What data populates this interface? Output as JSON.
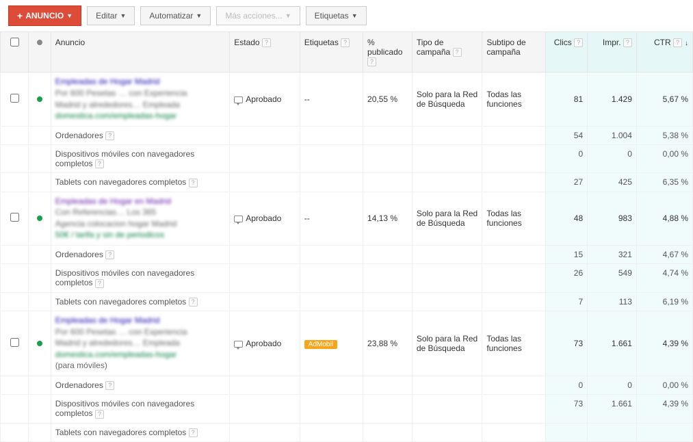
{
  "toolbar": {
    "primary": "Anuncio",
    "edit": "Editar",
    "automate": "Automatizar",
    "more": "Más acciones...",
    "labels": "Etiquetas"
  },
  "headers": {
    "ad": "Anuncio",
    "state": "Estado",
    "labels": "Etiquetas",
    "pct": "% publicado",
    "type": "Tipo de campaña",
    "subtype": "Subtipo de campaña",
    "clicks": "Clics",
    "impr": "Impr.",
    "ctr": "CTR"
  },
  "rows": [
    {
      "ad": {
        "t": "Empleadas de Hogar Madrid",
        "l1": "Por 600 Pesetas … con Experiencia",
        "l2": "Madrid y alrededores… Empleada",
        "l3": "domestica.com/empleadas-hogar",
        "mobiles": ""
      },
      "state": "Aprobado",
      "etq": "--",
      "pct": "20,55 %",
      "type": "Solo para la Red de Búsqueda",
      "sub": "Todas las funciones",
      "clicks": "81",
      "impr": "1.429",
      "ctr": "5,67 %",
      "devices": [
        {
          "name": "Ordenadores",
          "clicks": "54",
          "impr": "1.004",
          "ctr": "5,38 %"
        },
        {
          "name": "Dispositivos móviles con navegadores completos",
          "clicks": "0",
          "impr": "0",
          "ctr": "0,00 %"
        },
        {
          "name": "Tablets con navegadores completos",
          "clicks": "27",
          "impr": "425",
          "ctr": "6,35 %"
        }
      ]
    },
    {
      "ad": {
        "t": "Empleadas de Hogar en Madrid",
        "l1": "Con Referencias… Los 365",
        "l2": "Agencia colocacion hogar Madrid",
        "l3": "50€ / tarifa y sin de periodicos",
        "mobiles": "",
        "purple": true
      },
      "state": "Aprobado",
      "etq": "--",
      "pct": "14,13 %",
      "type": "Solo para la Red de Búsqueda",
      "sub": "Todas las funciones",
      "clicks": "48",
      "impr": "983",
      "ctr": "4,88 %",
      "devices": [
        {
          "name": "Ordenadores",
          "clicks": "15",
          "impr": "321",
          "ctr": "4,67 %"
        },
        {
          "name": "Dispositivos móviles con navegadores completos",
          "clicks": "26",
          "impr": "549",
          "ctr": "4,74 %"
        },
        {
          "name": "Tablets con navegadores completos",
          "clicks": "7",
          "impr": "113",
          "ctr": "6,19 %"
        }
      ]
    },
    {
      "ad": {
        "t": "Empleadas de Hogar Madrid",
        "l1": "Por 600 Pesetas … con Experiencia",
        "l2": "Madrid y alrededores… Empleada",
        "l3": "domestica.com/empleadas-hogar",
        "mobiles": "(para móviles)"
      },
      "state": "Aprobado",
      "etq_badge": "AdMobil",
      "pct": "23,88 %",
      "type": "Solo para la Red de Búsqueda",
      "sub": "Todas las funciones",
      "clicks": "73",
      "impr": "1.661",
      "ctr": "4,39 %",
      "devices": [
        {
          "name": "Ordenadores",
          "clicks": "0",
          "impr": "0",
          "ctr": "0,00 %"
        },
        {
          "name": "Dispositivos móviles con navegadores completos",
          "clicks": "73",
          "impr": "1.661",
          "ctr": "4,39 %"
        },
        {
          "name": "Tablets con navegadores completos",
          "clicks": "",
          "impr": "",
          "ctr": ""
        }
      ]
    }
  ]
}
